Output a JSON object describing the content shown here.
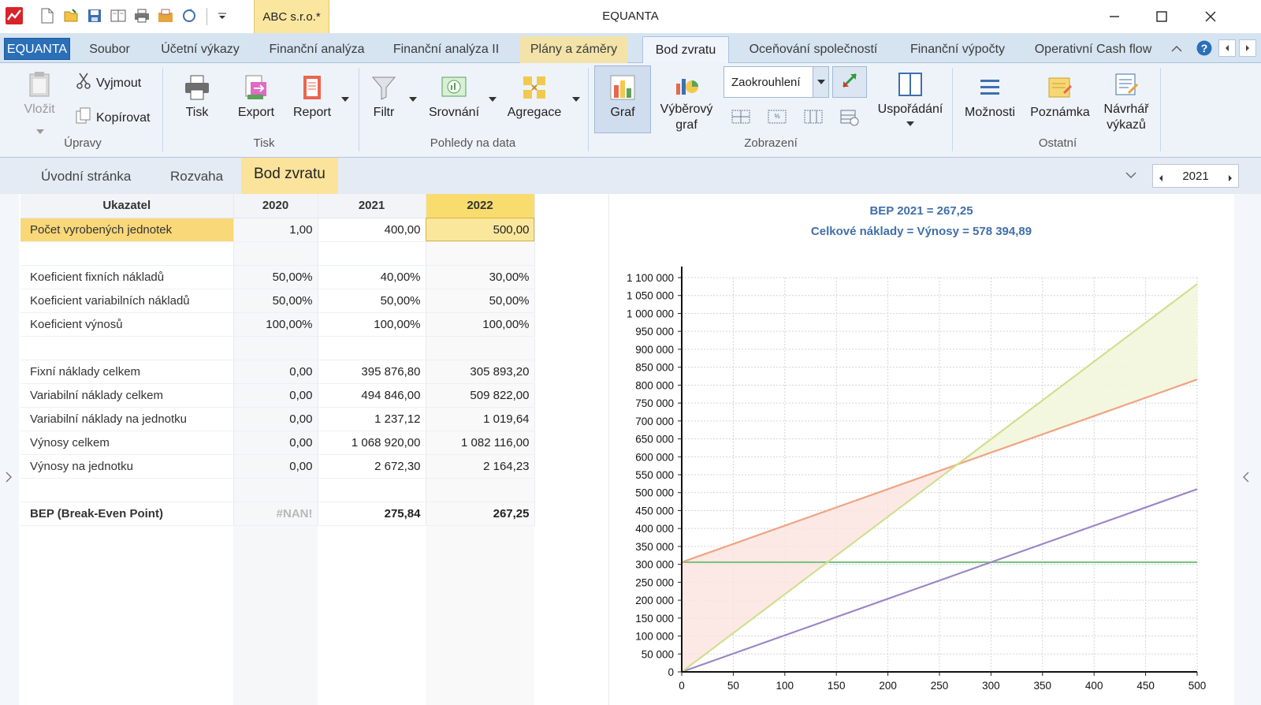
{
  "titlebar": {
    "doc_name": "ABC s.r.o.*",
    "app_title": "EQUANTA"
  },
  "ribbon_tabs": [
    {
      "label": "EQUANTA"
    },
    {
      "label": "Soubor"
    },
    {
      "label": "Účetní výkazy"
    },
    {
      "label": "Finanční analýza"
    },
    {
      "label": "Finanční analýza II"
    },
    {
      "label": "Plány a záměry"
    },
    {
      "label": "Bod zvratu"
    },
    {
      "label": "Oceňování společností"
    },
    {
      "label": "Finanční výpočty"
    },
    {
      "label": "Operativní Cash flow"
    }
  ],
  "ribbon": {
    "upravy": {
      "vlozit": "Vložit",
      "vyjmout": "Vyjmout",
      "kopirovat": "Kopírovat",
      "group": "Úpravy"
    },
    "tisk": {
      "tisk": "Tisk",
      "export": "Export",
      "report": "Report",
      "group": "Tisk"
    },
    "pohledy": {
      "filtr": "Filtr",
      "srovnani": "Srovnání",
      "agregace": "Agregace",
      "group": "Pohledy na data"
    },
    "zobrazeni": {
      "graf": "Graf",
      "vyberovy_1": "Výběrový",
      "vyberovy_2": "graf",
      "zaokrouhleni": "Zaokrouhlení",
      "usporadani": "Uspořádání",
      "group": "Zobrazení"
    },
    "ostatni": {
      "moznosti": "Možnosti",
      "poznamka": "Poznámka",
      "navrhar_1": "Návrhář",
      "navrhar_2": "výkazů",
      "group": "Ostatní"
    }
  },
  "page_tabs": [
    {
      "label": "Úvodní stránka"
    },
    {
      "label": "Rozvaha"
    },
    {
      "label": "Bod zvratu"
    }
  ],
  "year_nav": {
    "value": "2021"
  },
  "table": {
    "headers": [
      "Ukazatel",
      "2020",
      "2021",
      "2022"
    ],
    "rows": [
      {
        "name": "Počet vyrobených jednotek",
        "v": [
          "1,00",
          "400,00",
          "500,00"
        ]
      },
      {
        "name": "",
        "v": [
          "",
          "",
          ""
        ]
      },
      {
        "name": "Koeficient fixních nákladů",
        "v": [
          "50,00%",
          "40,00%",
          "30,00%"
        ]
      },
      {
        "name": "Koeficient variabilních nákladů",
        "v": [
          "50,00%",
          "50,00%",
          "50,00%"
        ]
      },
      {
        "name": "Koeficient výnosů",
        "v": [
          "100,00%",
          "100,00%",
          "100,00%"
        ]
      },
      {
        "name": "",
        "v": [
          "",
          "",
          ""
        ]
      },
      {
        "name": "Fixní náklady celkem",
        "v": [
          "0,00",
          "395 876,80",
          "305 893,20"
        ]
      },
      {
        "name": "Variabilní náklady celkem",
        "v": [
          "0,00",
          "494 846,00",
          "509 822,00"
        ]
      },
      {
        "name": "Variabilní náklady na jednotku",
        "v": [
          "0,00",
          "1 237,12",
          "1 019,64"
        ]
      },
      {
        "name": "Výnosy celkem",
        "v": [
          "0,00",
          "1 068 920,00",
          "1 082 116,00"
        ]
      },
      {
        "name": "Výnosy na jednotku",
        "v": [
          "0,00",
          "2 672,30",
          "2 164,23"
        ]
      },
      {
        "name": "",
        "v": [
          "",
          "",
          ""
        ]
      },
      {
        "name": "BEP (Break-Even Point)",
        "v": [
          "#NAN!",
          "275,84",
          "267,25"
        ]
      }
    ]
  },
  "chart_data": {
    "type": "line",
    "title": "BEP 2021 = 267,25",
    "subtitle": "Celkové náklady = Výnosy = 578 394,89",
    "xlim": [
      0,
      500
    ],
    "ylim": [
      0,
      1100000
    ],
    "x_ticks": [
      "0",
      "50",
      "100",
      "150",
      "200",
      "250",
      "300",
      "350",
      "400",
      "450",
      "500"
    ],
    "y_ticks": [
      "0",
      "50 000",
      "100 000",
      "150 000",
      "200 000",
      "250 000",
      "300 000",
      "350 000",
      "400 000",
      "450 000",
      "500 000",
      "550 000",
      "600 000",
      "650 000",
      "700 000",
      "750 000",
      "800 000",
      "850 000",
      "900 000",
      "950 000",
      "1 000 000",
      "1 050 000",
      "1 100 000"
    ],
    "grid": true,
    "series": [
      {
        "color": "#7cc47f",
        "x": [
          0,
          500
        ],
        "y": [
          305893,
          305893
        ]
      },
      {
        "color": "#9a86c6",
        "x": [
          0,
          500
        ],
        "y": [
          0,
          509822
        ]
      },
      {
        "color": "#f0a484",
        "x": [
          0,
          500
        ],
        "y": [
          305893,
          815715
        ]
      },
      {
        "color": "#cfe08f",
        "x": [
          0,
          500
        ],
        "y": [
          0,
          1082116
        ]
      }
    ],
    "break_even": {
      "x": 267.25,
      "y": 578394.89
    }
  }
}
